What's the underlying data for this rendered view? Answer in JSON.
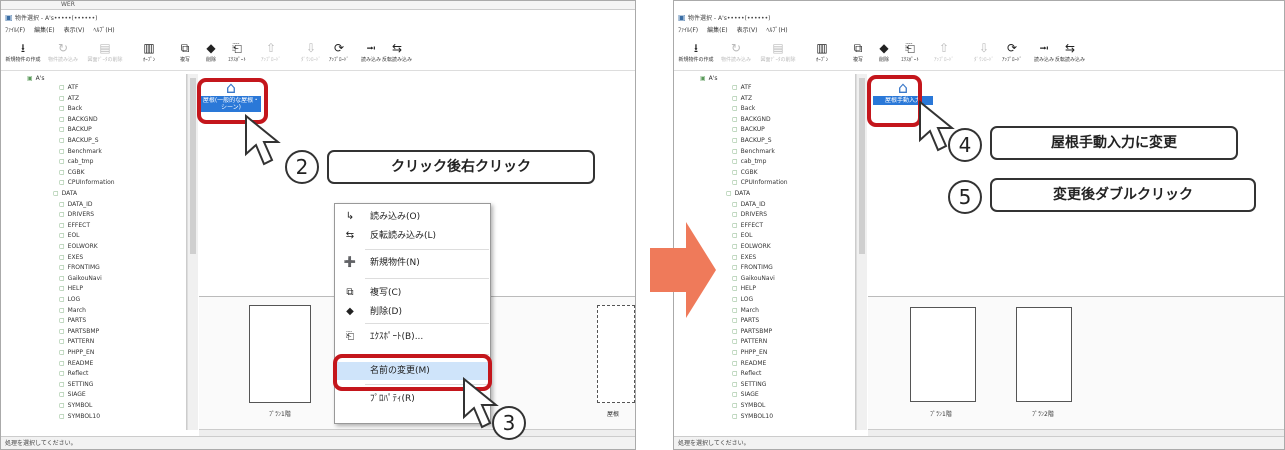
{
  "top_strip_text": "WER",
  "windows": [
    {
      "title": "物件選択 - A's•••••(••••••)",
      "menu": [
        "ﾌｧｲﾙ(F)",
        "編集(E)",
        "表示(V)",
        "ﾍﾙﾌﾟ(H)"
      ],
      "toolbar": [
        {
          "icon": "new-property-icon",
          "glyph": "⭳",
          "label": "新規物件の作成",
          "disabled": false
        },
        {
          "icon": "load-icon",
          "glyph": "↻",
          "label": "物件読み込み",
          "disabled": true
        },
        {
          "icon": "delete-file-icon",
          "glyph": "▤",
          "label": "図面ﾃﾞｰﾀの削除",
          "disabled": true
        },
        {
          "icon": "open-icon",
          "glyph": "▥",
          "label": "ｵｰﾌﾟﾝ",
          "disabled": false
        },
        {
          "icon": "copy-icon",
          "glyph": "⧉",
          "label": "複写",
          "disabled": false
        },
        {
          "icon": "delete-icon",
          "glyph": "◆",
          "label": "削除",
          "disabled": false
        },
        {
          "icon": "export-icon",
          "glyph": "⎗",
          "label": "ｴｸｽﾎﾟｰﾄ",
          "disabled": false
        },
        {
          "icon": "upload-icon",
          "glyph": "⇧",
          "label": "ｱｯﾌﾟﾛｰﾄﾞ",
          "disabled": true
        },
        {
          "icon": "download-icon",
          "glyph": "⇩",
          "label": "ﾀﾞｳﾝﾛｰﾄﾞ",
          "disabled": true
        },
        {
          "icon": "update-icon",
          "glyph": "⟳",
          "label": "ｱｯﾌﾟﾛｰﾄﾞ",
          "disabled": false
        },
        {
          "icon": "read-icon",
          "glyph": "⭲",
          "label": "読み込み",
          "disabled": false
        },
        {
          "icon": "reverse-read-icon",
          "glyph": "⇆",
          "label": "反転読み込み",
          "disabled": false
        }
      ],
      "status": "処理を選択してください。",
      "thumb_label": "屋根(一般的な屋根・シーン)"
    },
    {
      "title": "物件選択 - A's•••••(••••••)",
      "menu": [
        "ﾌｧｲﾙ(F)",
        "編集(E)",
        "表示(V)",
        "ﾍﾙﾌﾟ(H)"
      ],
      "status": "処理を選択してください。",
      "thumb_label": "屋根手動入力"
    }
  ],
  "tree": {
    "root": "A's",
    "items": [
      "ATF",
      "ATZ",
      "Back",
      "BACKGND",
      "BACKUP",
      "BACKUP_S",
      "Benchmark",
      "cab_tmp",
      "CGBK",
      "CPUInformation",
      "DATA",
      "DATA_ID",
      "DRIVERS",
      "EFFECT",
      "EOL",
      "EOLWORK",
      "EXES",
      "FRONTIMG",
      "GaikouNavi",
      "HELP",
      "LOG",
      "March",
      "PARTS",
      "PARTSBMP",
      "PATTERN",
      "PHPP_EN",
      "README",
      "Reflect",
      "SETTING",
      "SIAGE",
      "SYMBOL",
      "SYMBOL10"
    ]
  },
  "context_menu": [
    {
      "icon": "read-icon",
      "label": "読み込み(O)",
      "highlight": false
    },
    {
      "icon": "reverse-read-icon",
      "label": "反転読み込み(L)",
      "highlight": false
    },
    {
      "icon": "new-icon",
      "label": "新規物件(N)",
      "highlight": false
    },
    {
      "icon": "copy-icon",
      "label": "複写(C)",
      "highlight": false
    },
    {
      "icon": "delete-icon",
      "label": "削除(D)",
      "highlight": false
    },
    {
      "icon": "export-icon",
      "label": "ｴｸｽﾎﾟｰﾄ(B)...",
      "highlight": false
    },
    {
      "icon": "rename-icon",
      "label": "名前の変更(M)",
      "highlight": true
    },
    {
      "icon": "properties-icon",
      "label": "ﾌﾟﾛﾊﾟﾃｨ(R)",
      "highlight": false
    }
  ],
  "callouts": {
    "step2_num": "2",
    "step2_text": "クリック後右クリック",
    "step3_num": "3",
    "step4_num": "4",
    "step4_text": "屋根手動入力に変更",
    "step5_num": "5",
    "step5_text": "変更後ダブルクリック"
  },
  "plans": {
    "left_label": "ﾌﾟﾗﾝ1階",
    "right_label": "ﾌﾟﾗﾝ2階",
    "edge_label": "屋根",
    "right2_label": "ﾌﾟﾗﾝ1階"
  },
  "colors": {
    "accent": "#c4161c",
    "arrow": "#ef7a5a",
    "selection": "#2a78d8"
  }
}
